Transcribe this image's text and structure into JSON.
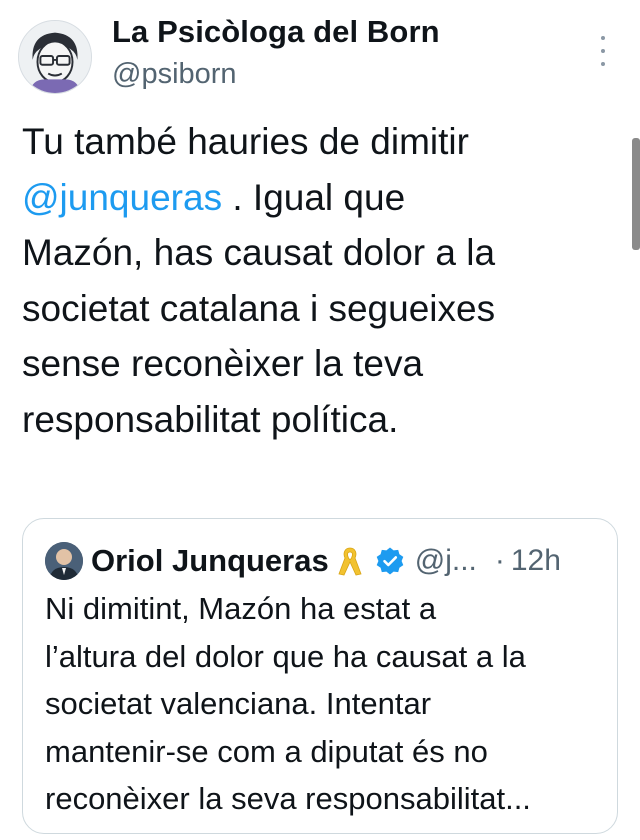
{
  "author": {
    "display_name": "La Psicòloga del Born",
    "handle": "@psiborn"
  },
  "tweet": {
    "line1": "Tu també hauries de dimitir",
    "mention": "@junqueras",
    "line2_rest": " . Igual que",
    "line3": "Mazón, has causat dolor a la",
    "line4": "societat catalana i segueixes",
    "line5": "sense reconèixer la teva",
    "line6": "responsabilitat política."
  },
  "quote": {
    "display_name": "Oriol Junqueras",
    "handle": "@j...",
    "separator": "·",
    "time": "12h",
    "lines": [
      "Ni dimitint, Mazón ha estat a",
      "l’altura del dolor que ha causat a la",
      "societat valenciana. Intentar",
      "mantenir-se com a diputat és no",
      "reconèixer la seva responsabilitat..."
    ]
  },
  "icons": {
    "more": "more-vertical-icon",
    "ribbon": "yellow-ribbon-icon",
    "verified": "verified-badge-icon"
  },
  "colors": {
    "link": "#1d9bf0",
    "secondary_text": "#536471",
    "ribbon": "#f2c230",
    "verified": "#1d9bf0"
  }
}
